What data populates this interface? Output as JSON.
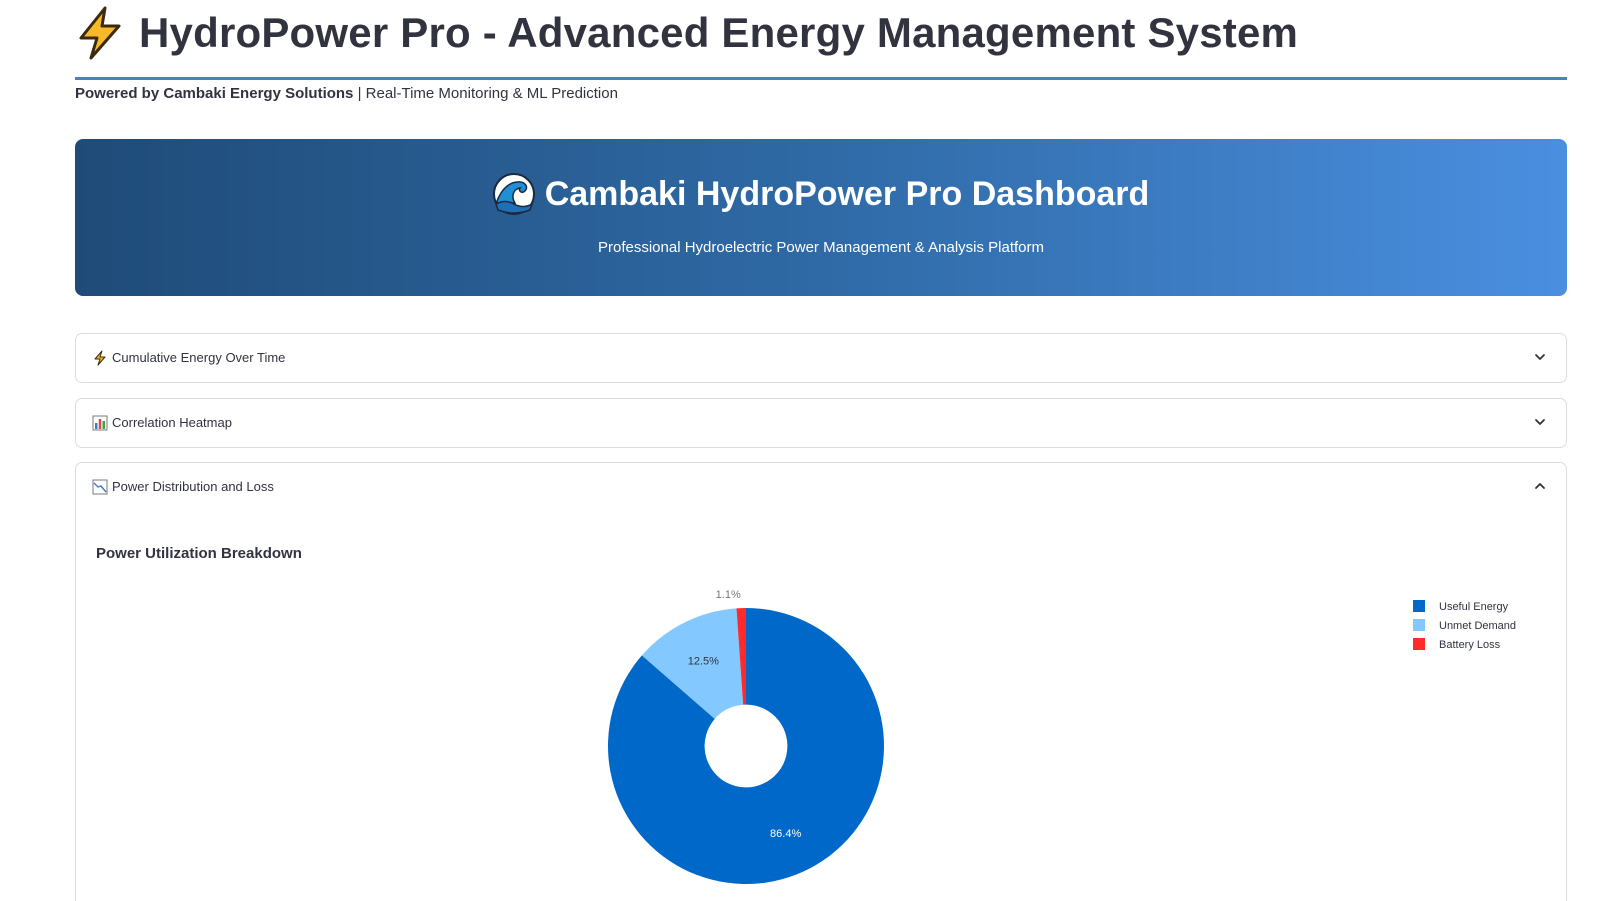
{
  "header": {
    "title": "HydroPower Pro - Advanced Energy Management System",
    "icon": "lightning-bolt-icon",
    "byline_bold": "Powered by Cambaki Energy Solutions",
    "byline_rest": " | Real-Time Monitoring & ML Prediction",
    "rule_color": "#4a7fc8"
  },
  "hero": {
    "icon": "wave-icon",
    "title": "Cambaki HydroPower Pro Dashboard",
    "subtitle": "Professional Hydroelectric Power Management & Analysis Platform",
    "gradient_start": "#1f4b78",
    "gradient_end": "#4a8fe0"
  },
  "expanders": [
    {
      "label": "Cumulative Energy Over Time",
      "icon": "lightning-bolt-icon",
      "state": "collapsed"
    },
    {
      "label": "Correlation Heatmap",
      "icon": "bar-chart-icon",
      "state": "collapsed"
    },
    {
      "label": "Power Distribution and Loss",
      "icon": "line-chart-icon",
      "state": "expanded"
    }
  ],
  "power_section": {
    "title": "Power Utilization Breakdown"
  },
  "chart_data": {
    "type": "pie",
    "hole": 0.3,
    "categories": [
      "Useful Energy",
      "Unmet Demand",
      "Battery Loss"
    ],
    "values": [
      86.4,
      12.5,
      1.1
    ],
    "labels": [
      "86.4%",
      "12.5%",
      "1.1%"
    ],
    "colors": [
      "#0068c9",
      "#83c9ff",
      "#ff2b2b"
    ],
    "legend": "top-right"
  }
}
